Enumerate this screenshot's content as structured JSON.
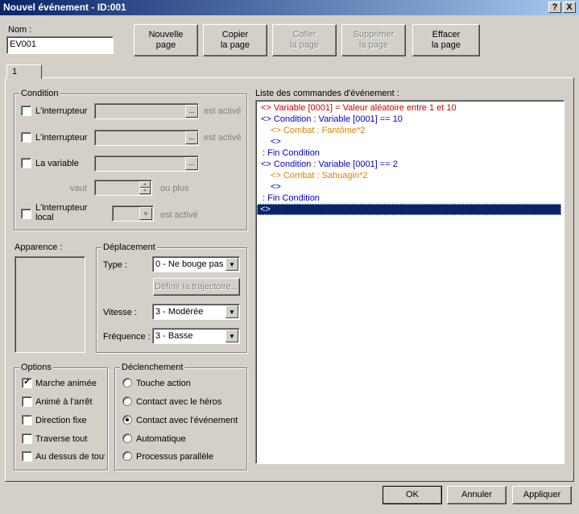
{
  "window": {
    "title": "Nouvel événement - ID:001",
    "help_label": "?",
    "close_label": "X"
  },
  "name": {
    "label": "Nom :",
    "value": "EV001"
  },
  "toolbar": {
    "new_page": [
      "Nouvelle",
      "page"
    ],
    "copy_page": [
      "Copier",
      "la page"
    ],
    "paste_page": [
      "Coller",
      "la page"
    ],
    "delete_page": [
      "Supprimer",
      "la page"
    ],
    "clear_page": [
      "Effacer",
      "la page"
    ]
  },
  "tab": {
    "label": "1"
  },
  "condition": {
    "legend": "Condition",
    "switch1_label": "L'interrupteur",
    "switch1_suffix": "est activé",
    "switch2_label": "L'interrupteur",
    "switch2_suffix": "est activé",
    "variable_label": "La variable",
    "value_label": "vaut",
    "value_suffix": "ou plus",
    "local_switch_label": "L'interrupteur local",
    "local_suffix": "est activé",
    "ellipsis": "..."
  },
  "appearance": {
    "label": "Apparence :"
  },
  "movement": {
    "legend": "Déplacement",
    "type_label": "Type :",
    "type_value": "0 - Ne bouge pas",
    "route_button": "Définir la trajectoire...",
    "speed_label": "Vitesse :",
    "speed_value": "3 - Modérée",
    "freq_label": "Fréquence :",
    "freq_value": "3 - Basse"
  },
  "options": {
    "legend": "Options",
    "items": [
      {
        "label": "Marche animée",
        "checked": "✔"
      },
      {
        "label": "Animé à l'arrêt",
        "checked": ""
      },
      {
        "label": "Direction fixe",
        "checked": ""
      },
      {
        "label": "Traverse tout",
        "checked": ""
      },
      {
        "label": "Au dessus de tout",
        "checked": ""
      }
    ]
  },
  "trigger": {
    "legend": "Déclenchement",
    "items": [
      {
        "label": "Touche action"
      },
      {
        "label": "Contact avec le héros"
      },
      {
        "label": "Contact avec l'événement"
      },
      {
        "label": "Automatique"
      },
      {
        "label": "Processus parallèle"
      }
    ],
    "selected_index": 2
  },
  "commands": {
    "label": "Liste des commandes d'événement :",
    "lines": [
      "<> Variable [0001] = Valeur aléatoire entre 1 et 10",
      "<> Condition : Variable [0001] == 10",
      "<> Combat : Fantôme*2",
      "<>",
      ": Fin Condition",
      "<> Condition : Variable [0001] == 2",
      "<> Combat : Sahuagin*2",
      "<>",
      ": Fin Condition",
      "<>"
    ],
    "colors": {
      "variable": "#cc0000",
      "condition": "#0000cc",
      "combat": "#e08000",
      "selection": "#0a246a"
    }
  },
  "footer": {
    "ok": "OK",
    "cancel": "Annuler",
    "apply": "Appliquer"
  }
}
